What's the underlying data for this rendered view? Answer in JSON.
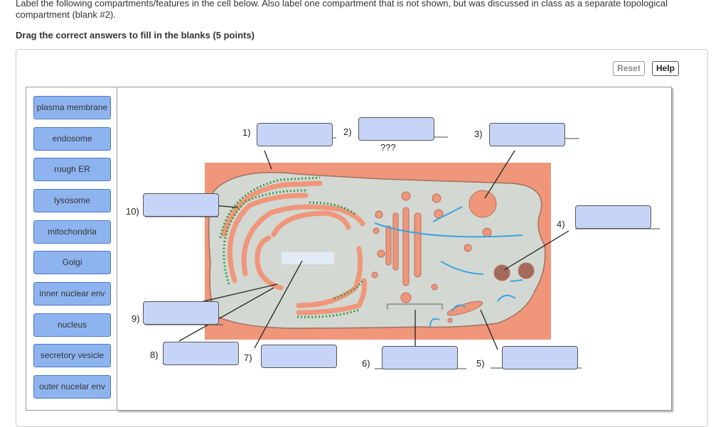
{
  "instructions": "Label the following compartments/features in the cell below.  Also label one compartment that is not shown, but was discussed in class as a separate topological compartment (blank #2).",
  "prompt": "Drag the correct answers to fill in the blanks (5 points)",
  "toolbar": {
    "reset_label": "Reset",
    "help_label": "Help"
  },
  "answer_bank": [
    "plasma membrane",
    "endosome",
    "rough ER",
    "lysosome",
    "mitochondria",
    "Golgi",
    "inner nuclear env",
    "nucleus",
    "secretory vesicle",
    "outer nucelar env"
  ],
  "blanks": {
    "b1": "1)",
    "b2": "2)",
    "b3": "3)",
    "b4": "4)",
    "b5": "5)",
    "b6": "6)",
    "b7": "7)",
    "b8": "8)",
    "b9": "9)",
    "b10": "10)"
  },
  "unknown_label": "???",
  "colors": {
    "chip": "#8eb4f0",
    "drop": "#c6d5f7",
    "cell_bg": "#f0967a",
    "cytoplasm": "#d3d8d2",
    "ribosome": "#2e9e4a",
    "arrow": "#3aa5e0"
  }
}
